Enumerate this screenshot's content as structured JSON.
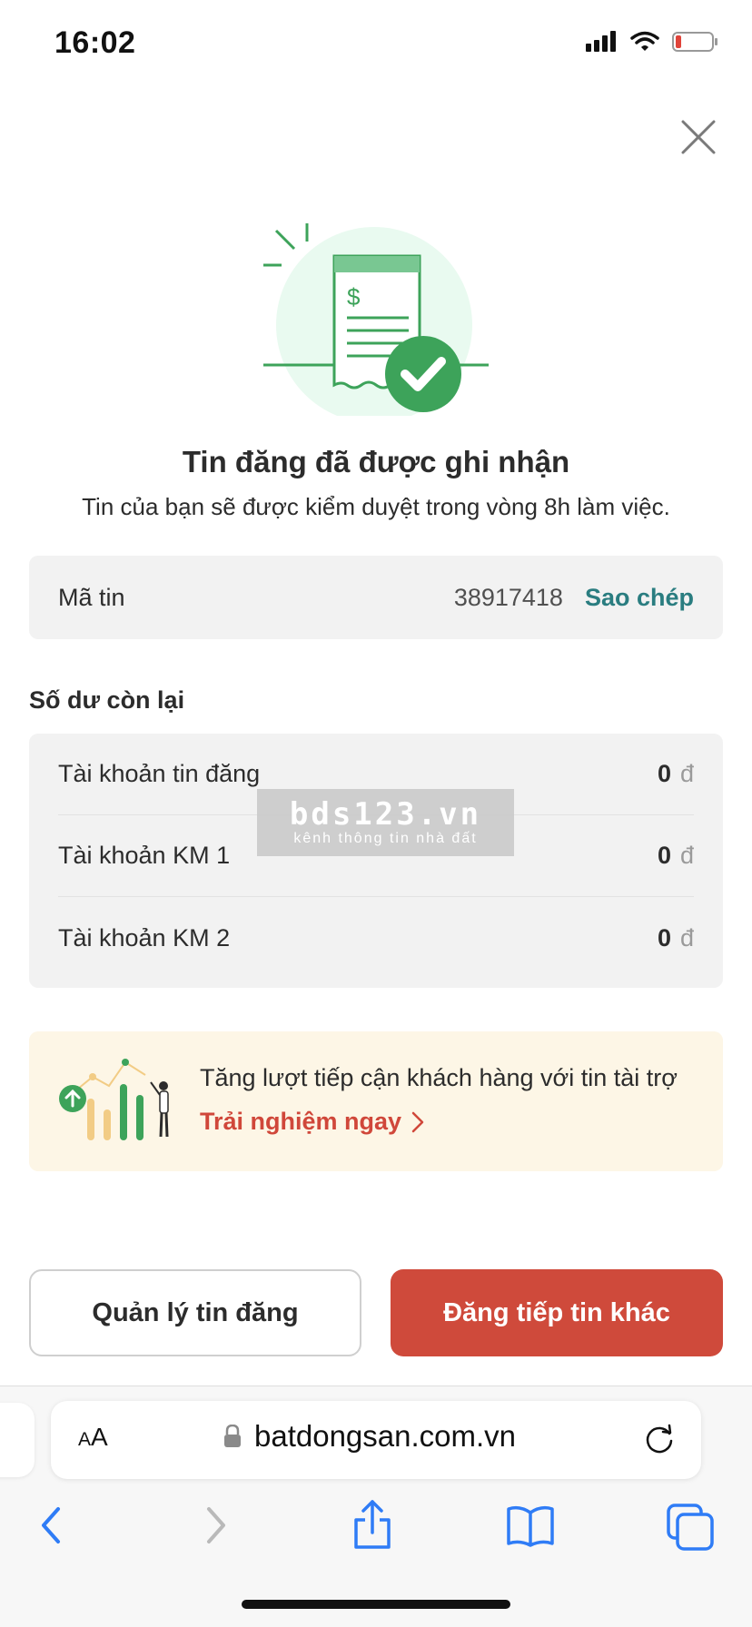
{
  "status_bar": {
    "time": "16:02"
  },
  "confirmation": {
    "title": "Tin đăng đã được ghi nhận",
    "subtitle": "Tin của bạn sẽ được kiểm duyệt trong vòng 8h làm việc."
  },
  "listing_code": {
    "label": "Mã tin",
    "value": "38917418",
    "copy_label": "Sao chép"
  },
  "balance": {
    "title": "Số dư còn lại",
    "rows": [
      {
        "label": "Tài khoản tin đăng",
        "value": "0",
        "unit": "đ"
      },
      {
        "label": "Tài khoản KM 1",
        "value": "0",
        "unit": "đ"
      },
      {
        "label": "Tài khoản KM 2",
        "value": "0",
        "unit": "đ"
      }
    ]
  },
  "watermark": {
    "main": "bds123.vn",
    "sub": "kênh thông tin nhà đất"
  },
  "promo": {
    "text": "Tăng lượt tiếp cận khách hàng với tin tài trợ",
    "link": "Trải nghiệm ngay"
  },
  "actions": {
    "manage_label": "Quản lý tin đăng",
    "post_another_label": "Đăng tiếp tin khác"
  },
  "browser": {
    "aa_label_small": "A",
    "aa_label_big": "A",
    "url": "batdongsan.com.vn"
  },
  "colors": {
    "brand_red": "#cf4a3b",
    "success_green": "#3da35a",
    "link_teal": "#2a7d80",
    "promo_bg": "#fdf6e6"
  },
  "icons": [
    "signal-icon",
    "wifi-icon",
    "battery-icon",
    "close-icon",
    "lock-icon",
    "reload-icon",
    "back-icon",
    "forward-icon",
    "share-icon",
    "bookmarks-icon",
    "tabs-icon"
  ]
}
